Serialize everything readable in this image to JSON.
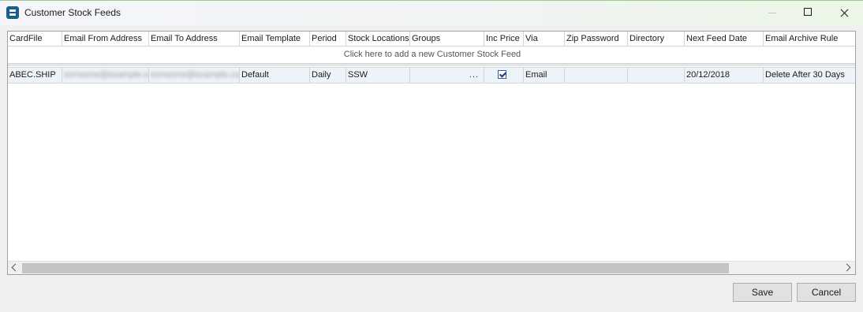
{
  "window": {
    "title": "Customer Stock Feeds",
    "controls": [
      "minimize",
      "maximize",
      "close"
    ]
  },
  "grid": {
    "columns": [
      "CardFile",
      "Email From Address",
      "Email To Address",
      "Email Template",
      "Period",
      "Stock Locations",
      "Groups",
      "Inc Price",
      "Via",
      "Zip Password",
      "Directory",
      "Next Feed Date",
      "Email Archive Rule"
    ],
    "new_row_text": "Click here to add a new Customer Stock Feed",
    "rows": [
      {
        "cardfile": "ABEC.SHIP",
        "email_from": "someone@example.com",
        "email_to": "someone@example.com",
        "email_template": "Default",
        "period": "Daily",
        "stock_locations": "SSW",
        "groups": "",
        "groups_button": "...",
        "inc_price": true,
        "via": "Email",
        "zip_password": "",
        "directory": "",
        "next_feed_date": "20/12/2018",
        "email_archive_rule": "Delete After 30 Days"
      }
    ]
  },
  "footer": {
    "save_label": "Save",
    "cancel_label": "Cancel"
  },
  "colors": {
    "selected_row": "#eef3fa",
    "checkbox_border": "#2b5fa3",
    "app_icon": "#1b5c8f"
  }
}
